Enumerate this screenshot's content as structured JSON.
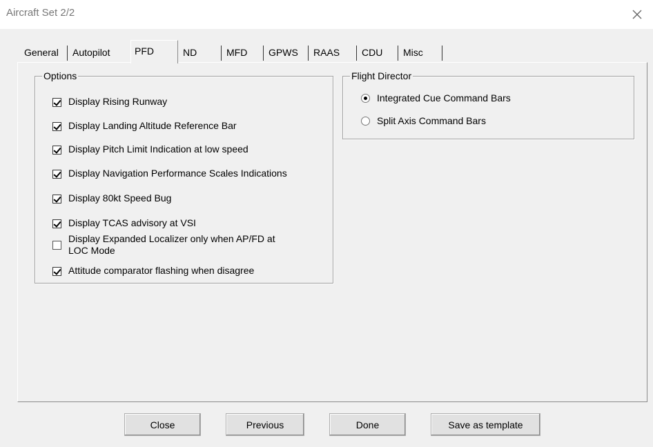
{
  "window": {
    "title": "Aircraft Set 2/2",
    "close_icon": "close-icon"
  },
  "tabs": [
    {
      "label": "General",
      "active": false
    },
    {
      "label": "Autopilot",
      "active": false
    },
    {
      "label": "PFD",
      "active": true
    },
    {
      "label": "ND",
      "active": false
    },
    {
      "label": "MFD",
      "active": false
    },
    {
      "label": "GPWS",
      "active": false
    },
    {
      "label": "RAAS",
      "active": false
    },
    {
      "label": "CDU",
      "active": false
    },
    {
      "label": "Misc",
      "active": false
    }
  ],
  "options_group": {
    "title": "Options",
    "items": [
      {
        "label": "Display Rising Runway",
        "checked": true
      },
      {
        "label": "Display Landing Altitude Reference Bar",
        "checked": true
      },
      {
        "label": "Display Pitch Limit Indication at low speed",
        "checked": true
      },
      {
        "label": "Display Navigation Performance Scales Indications",
        "checked": true
      },
      {
        "label": "Display 80kt Speed Bug",
        "checked": true
      },
      {
        "label": "Display TCAS advisory at VSI",
        "checked": true
      },
      {
        "label": "Display Expanded Localizer only when AP/FD at",
        "label_line2": "LOC Mode",
        "checked": false
      },
      {
        "label": "Attitude comparator flashing when disagree",
        "checked": true
      }
    ]
  },
  "flight_director_group": {
    "title": "Flight Director",
    "options": [
      {
        "label": "Integrated Cue Command Bars",
        "selected": true
      },
      {
        "label": "Split Axis Command Bars",
        "selected": false
      }
    ]
  },
  "buttons": {
    "close": "Close",
    "previous": "Previous",
    "done": "Done",
    "save_template": "Save as template"
  }
}
